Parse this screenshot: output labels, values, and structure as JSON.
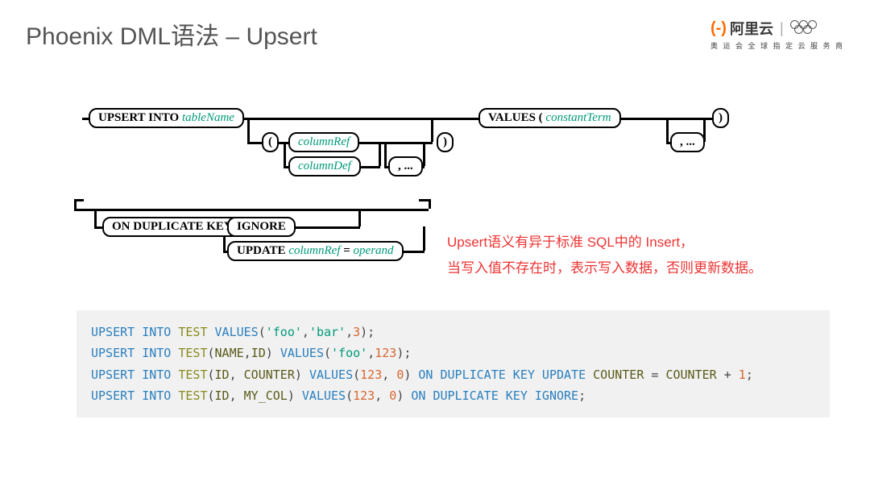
{
  "title": "Phoenix DML语法 – Upsert",
  "logo": {
    "brand": "阿里云",
    "tagline": "奥 运 会 全 球 指 定 云 服 务 商"
  },
  "diagram": {
    "row1": {
      "upsert": "UPSERT INTO",
      "table": "tableName",
      "lparen": "(",
      "columnRef": "columnRef",
      "rparen": ")",
      "columnDef": "columnDef",
      "dots": ", ...",
      "values": "VALUES (",
      "constantTerm": "constantTerm",
      "rparen2": ")",
      "dots2": ", ..."
    },
    "row2": {
      "onDup": "ON DUPLICATE KEY",
      "ignore": "IGNORE",
      "update": "UPDATE",
      "columnRef": "columnRef",
      "eq": "=",
      "operand": "operand"
    }
  },
  "note": {
    "line1": "Upsert语义有异于标准 SQL中的 Insert，",
    "line2": "当写入值不存在时，表示写入数据，否则更新数据。"
  },
  "code": {
    "l1": {
      "a": "UPSERT INTO",
      "b": "TEST",
      "c": "VALUES",
      "d": "'foo'",
      "e": "'bar'",
      "f": "3"
    },
    "l2": {
      "a": "UPSERT INTO",
      "b": "TEST",
      "c1": "NAME",
      "c2": "ID",
      "d": "VALUES",
      "e": "'foo'",
      "f": "123"
    },
    "l3": {
      "a": "UPSERT INTO",
      "b": "TEST",
      "c1": "ID",
      "c2": "COUNTER",
      "d": "VALUES",
      "e": "123",
      "f": "0",
      "g": "ON DUPLICATE KEY UPDATE",
      "h": "COUNTER",
      "i": "COUNTER",
      "j": "1"
    },
    "l4": {
      "a": "UPSERT INTO",
      "b": "TEST",
      "c1": "ID",
      "c2": "MY_COL",
      "d": "VALUES",
      "e": "123",
      "f": "0",
      "g": "ON DUPLICATE KEY IGNORE"
    }
  }
}
